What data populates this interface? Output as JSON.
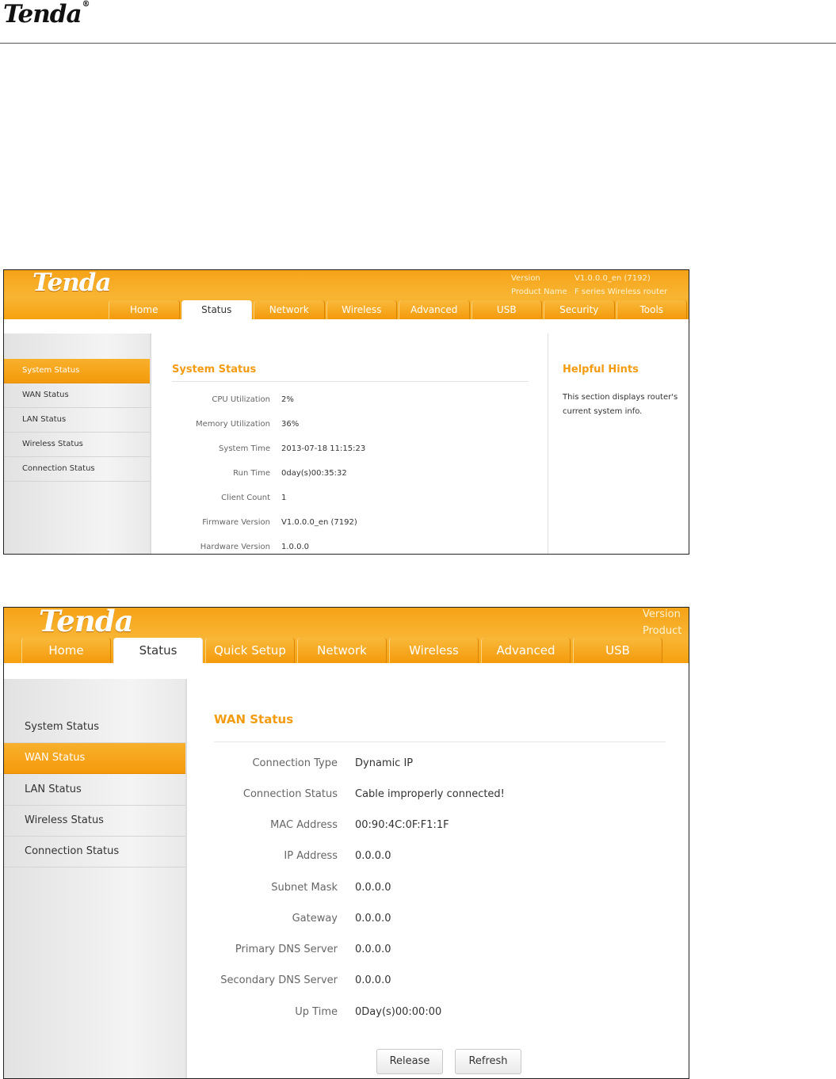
{
  "document": {
    "logo_text": "Tenda",
    "reg_mark": "®"
  },
  "shot1": {
    "logo_text": "Tenda",
    "version_label": "Version",
    "version_value": "V1.0.0.0_en (7192)",
    "product_label": "Product Name",
    "product_value": "F series Wireless router",
    "tabs": [
      "Home",
      "Status",
      "Network",
      "Wireless",
      "Advanced",
      "USB",
      "Security",
      "Tools"
    ],
    "active_tab": "Status",
    "sidebar": [
      "System Status",
      "WAN Status",
      "LAN Status",
      "Wireless Status",
      "Connection Status"
    ],
    "active_sidebar": "System Status",
    "section_title": "System Status",
    "rows": [
      {
        "label": "CPU Utilization",
        "value": "2%"
      },
      {
        "label": "Memory Utilization",
        "value": "36%"
      },
      {
        "label": "System Time",
        "value": "2013-07-18 11:15:23"
      },
      {
        "label": "Run Time",
        "value": "0day(s)00:35:32"
      },
      {
        "label": "Client Count",
        "value": "1"
      },
      {
        "label": "Firmware Version",
        "value": "V1.0.0.0_en (7192)"
      },
      {
        "label": "Hardware Version",
        "value": "1.0.0.0"
      }
    ],
    "hints_title": "Helpful Hints",
    "hints_text": "This section displays router's current system info."
  },
  "shot2": {
    "logo_text": "Tenda",
    "version_label": "Version",
    "product_label": "Product",
    "tabs": [
      "Home",
      "Status",
      "Quick Setup",
      "Network",
      "Wireless",
      "Advanced",
      "USB"
    ],
    "active_tab": "Status",
    "sidebar": [
      "System Status",
      "WAN Status",
      "LAN Status",
      "Wireless Status",
      "Connection Status"
    ],
    "active_sidebar": "WAN Status",
    "section_title": "WAN Status",
    "rows": [
      {
        "label": "Connection Type",
        "value": "Dynamic IP"
      },
      {
        "label": "Connection Status",
        "value": "Cable improperly connected!"
      },
      {
        "label": "MAC Address",
        "value": "00:90:4C:0F:F1:1F"
      },
      {
        "label": "IP Address",
        "value": "0.0.0.0"
      },
      {
        "label": "Subnet Mask",
        "value": "0.0.0.0"
      },
      {
        "label": "Gateway",
        "value": "0.0.0.0"
      },
      {
        "label": "Primary DNS Server",
        "value": "0.0.0.0"
      },
      {
        "label": "Secondary DNS Server",
        "value": "0.0.0.0"
      },
      {
        "label": "Up Time",
        "value": "0Day(s)00:00:00"
      }
    ],
    "release_label": "Release",
    "refresh_label": "Refresh"
  }
}
